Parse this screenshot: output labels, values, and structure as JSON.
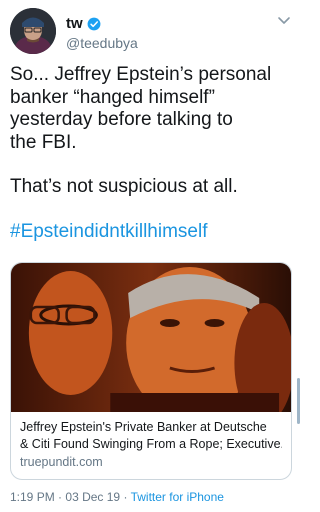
{
  "author": {
    "name": "tw",
    "handle": "@teedubya",
    "verified": true,
    "avatar_icon": "profile-photo-icon"
  },
  "tweet": {
    "lines": [
      "So... Jeffrey Epstein’s personal",
      "banker “hanged himself”",
      "yesterday before talking to",
      "the FBI."
    ],
    "second_paragraph": "That’s not suspicious at all.",
    "hashtag": "#Epsteindidntkillhimself"
  },
  "card": {
    "title_line1": "Jeffrey Epstein's Private Banker at Deutsche",
    "title_line2": "& Citi Found Swinging From a Rope; Executive...",
    "domain": "truepundit.com"
  },
  "meta": {
    "time": "1:19 PM",
    "separator": "·",
    "date": "03 Dec 19",
    "source": "Twitter for iPhone"
  },
  "colors": {
    "link": "#1b95e0",
    "secondary_text": "#657786",
    "verified_badge": "#1da1f2"
  }
}
